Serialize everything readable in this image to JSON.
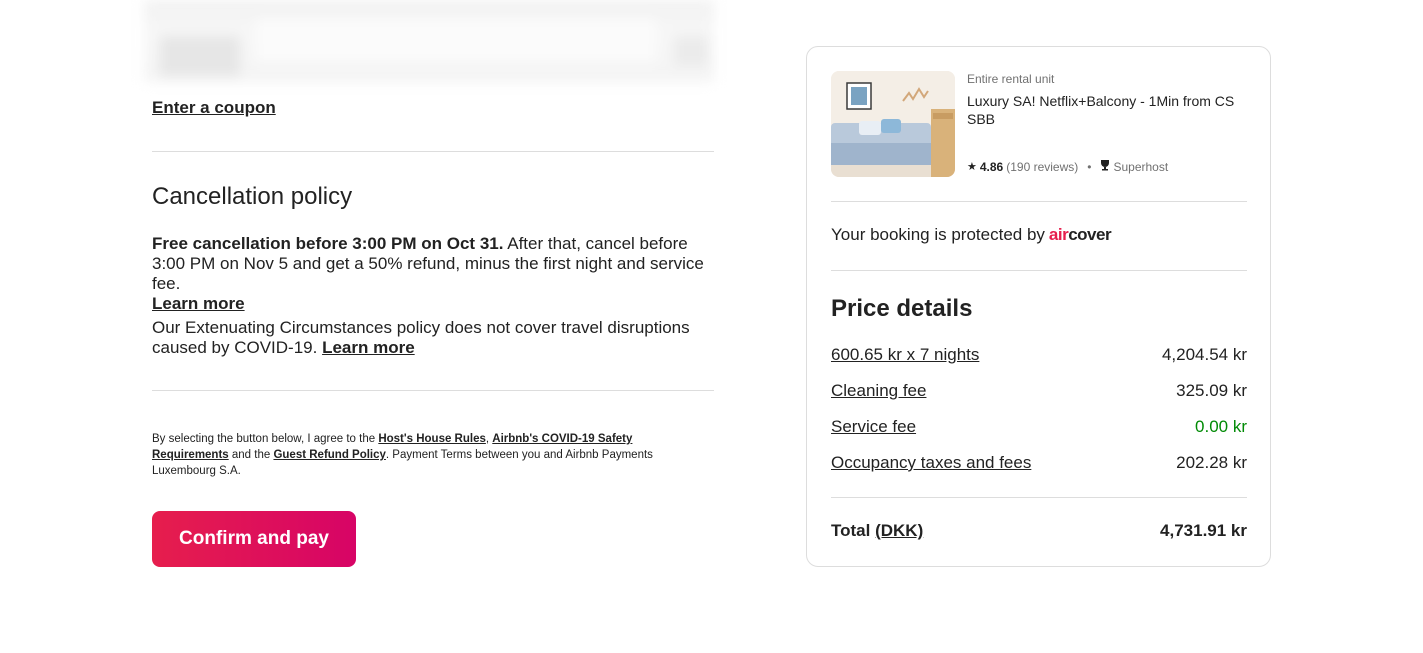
{
  "checkout": {
    "coupon_link": "Enter a coupon",
    "cancellation": {
      "title": "Cancellation policy",
      "bold_text": "Free cancellation before 3:00 PM on Oct 31.",
      "text": " After that, cancel before 3:00 PM on Nov 5 and get a 50% refund, minus the first night and service fee.",
      "learn_more": "Learn more"
    },
    "covid": {
      "text": "Our Extenuating Circumstances policy does not cover travel disruptions caused by COVID-19. ",
      "learn_more": "Learn more"
    },
    "legal": {
      "prefix": "By selecting the button below, I agree to the ",
      "house_rules": "Host's House Rules",
      "comma": ", ",
      "covid_req": "Airbnb's COVID-19 Safety Requirements",
      "and_the": " and the ",
      "refund_policy": "Guest Refund Policy",
      "suffix": ". Payment Terms between you and Airbnb Payments Luxembourg S.A."
    },
    "confirm_button": "Confirm and pay"
  },
  "listing": {
    "unit_type": "Entire rental unit",
    "title": "Luxury SA! Netflix+Balcony - 1Min from CS SBB",
    "rating": "4.86",
    "reviews": "(190 reviews)",
    "separator": "•",
    "superhost": "Superhost"
  },
  "protection": {
    "text": "Your booking is protected by",
    "brand_air": "air",
    "brand_cover": "cover"
  },
  "price": {
    "title": "Price details",
    "rows": [
      {
        "label": "600.65 kr x 7 nights",
        "amount": "4,204.54 kr"
      },
      {
        "label": "Cleaning fee",
        "amount": "325.09 kr"
      },
      {
        "label": "Service fee",
        "amount": "0.00 kr"
      },
      {
        "label": "Occupancy taxes and fees",
        "amount": "202.28 kr"
      }
    ],
    "total_label": "Total",
    "total_currency": "(DKK)",
    "total_amount": "4,731.91 kr"
  },
  "colors": {
    "accent": "#e61e4d",
    "discount_green": "#008a05"
  },
  "icons": [
    "star-icon",
    "superhost-trophy-icon"
  ]
}
